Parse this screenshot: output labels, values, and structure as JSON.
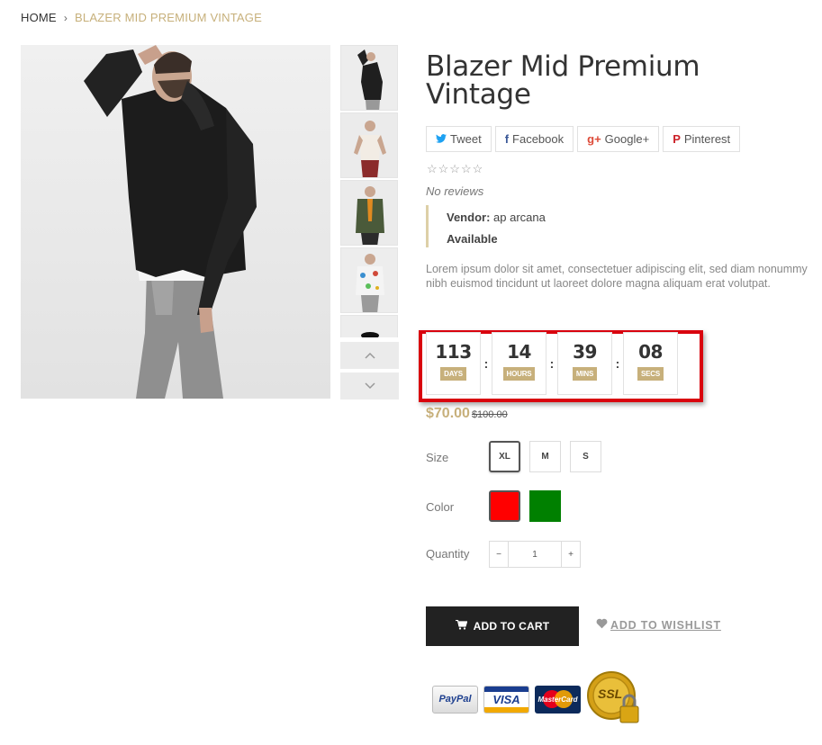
{
  "breadcrumb": {
    "home": "HOME",
    "separator": "›",
    "current": "BLAZER MID PREMIUM VINTAGE"
  },
  "product": {
    "title": "Blazer Mid Premium Vintage",
    "no_reviews": "No reviews",
    "rating_stars": "☆☆☆☆☆",
    "vendor_label": "Vendor:",
    "vendor_name": "ap arcana",
    "availability": "Available",
    "description": "Lorem ipsum dolor sit amet, consectetuer adipiscing elit, sed diam nonummy nibh euismod tincidunt ut laoreet dolore magna aliquam erat volutpat."
  },
  "share": [
    {
      "label": "Tweet",
      "icon": "twitter-icon",
      "glyph": "🐦",
      "color": "#1da1f2"
    },
    {
      "label": "Facebook",
      "icon": "facebook-icon",
      "glyph": "f",
      "color": "#3b5998"
    },
    {
      "label": "Google+",
      "icon": "google-plus-icon",
      "glyph": "g+",
      "color": "#dd4b39"
    },
    {
      "label": "Pinterest",
      "icon": "pinterest-icon",
      "glyph": "P",
      "color": "#cb2027"
    }
  ],
  "countdown": {
    "days": "113",
    "days_label": "DAYS",
    "hours": "14",
    "hours_label": "HOURS",
    "mins": "39",
    "mins_label": "MINS",
    "secs": "08",
    "secs_label": "SECS",
    "separator": ":"
  },
  "price": {
    "current": "$70.00",
    "original": "$100.00"
  },
  "options": {
    "size_label": "Size",
    "sizes": [
      "XL",
      "M",
      "S"
    ],
    "selected_size": "XL",
    "color_label": "Color",
    "colors": [
      "#ff0000",
      "#008000"
    ],
    "selected_color": "#ff0000",
    "quantity_label": "Quantity",
    "quantity": "1",
    "minus": "−",
    "plus": "+"
  },
  "actions": {
    "add_to_cart": "ADD TO CART",
    "add_to_wishlist": "ADD TO WISHLIST"
  },
  "payment": {
    "paypal": "PayPal",
    "visa": "VISA",
    "mastercard": "MasterCard",
    "ssl": "SSL"
  },
  "colors": {
    "accent": "#c7b07b",
    "highlight_frame": "#d9030e",
    "button_dark": "#222222"
  }
}
